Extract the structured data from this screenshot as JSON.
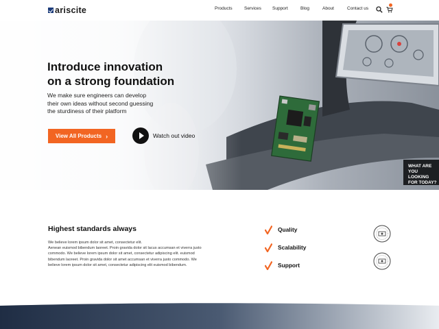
{
  "brand": {
    "name": "ariscite"
  },
  "nav": {
    "links": [
      {
        "label": "Products"
      },
      {
        "label": "Services"
      },
      {
        "label": "Support"
      },
      {
        "label": "Blog"
      },
      {
        "label": "About"
      },
      {
        "label": "Contact us"
      }
    ],
    "icons": [
      "search-icon",
      "cart-icon"
    ]
  },
  "hero": {
    "title_line1": "Introduce innovation",
    "title_line2": "on a strong foundation",
    "subtitle": "We make sure engineers can develop their own ideas without second guessing the sturdiness of their platform",
    "primary_button": "View All Products",
    "video_label": "Watch out video",
    "help_line1": "WHAT ARE",
    "help_line2": "YOU LOOKING",
    "help_line3": "FOR TODAY?"
  },
  "standards": {
    "title": "Highest standards always",
    "body_line1": "We believe lorem ipsum dolor sit amet, consectetur elit.",
    "body_rest": "Aenean euismod bibendum laoreet. Proin gravida dolor sit  lacus accumsan et viverra justo commodo. We believe lorem ipsum dolor sit amet, consectetur adipiscing elit. euismod bibendum laoreet. Proin gravida dolor sit amet accumsan et viverra justo commodo. We believe lorem ipsum dolor sit amet, consectetur adipiscing elit euismod bibendum.",
    "features": [
      {
        "label": "Quality"
      },
      {
        "label": "Scalability"
      },
      {
        "label": "Support"
      }
    ]
  },
  "colors": {
    "accent": "#f26522",
    "brand_blue": "#1c3c7a",
    "dark": "#1d1f22"
  }
}
